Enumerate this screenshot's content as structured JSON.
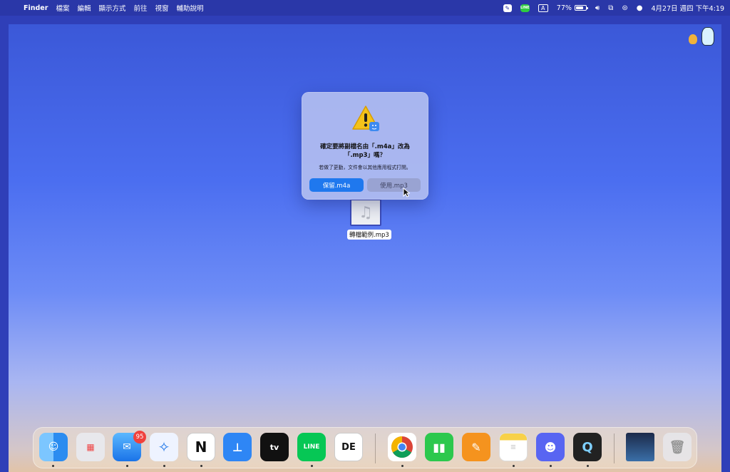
{
  "menubar": {
    "apple": "",
    "app_name": "Finder",
    "menus": [
      "檔案",
      "編輯",
      "顯示方式",
      "前往",
      "視窗",
      "輔助說明"
    ],
    "line_label": "LINE",
    "input_label": "A",
    "battery": "77%",
    "datetime": "4月27日 週四 下午4:19"
  },
  "dialog": {
    "title_line1": "確定要將副檔名由「.m4a」改為",
    "title_line2": "「.mp3」嗎？",
    "message": "若做了更動，文件會以其他應用程式打開。",
    "keep_button": "保留.m4a",
    "use_button": "使用.mp3"
  },
  "file": {
    "name": "轉檔範例.mp3",
    "icon": "music-note-icon"
  },
  "dock": {
    "mail_badge": "95",
    "appletv_label": "tv",
    "line_label": "LINE",
    "de_label": "DE"
  }
}
